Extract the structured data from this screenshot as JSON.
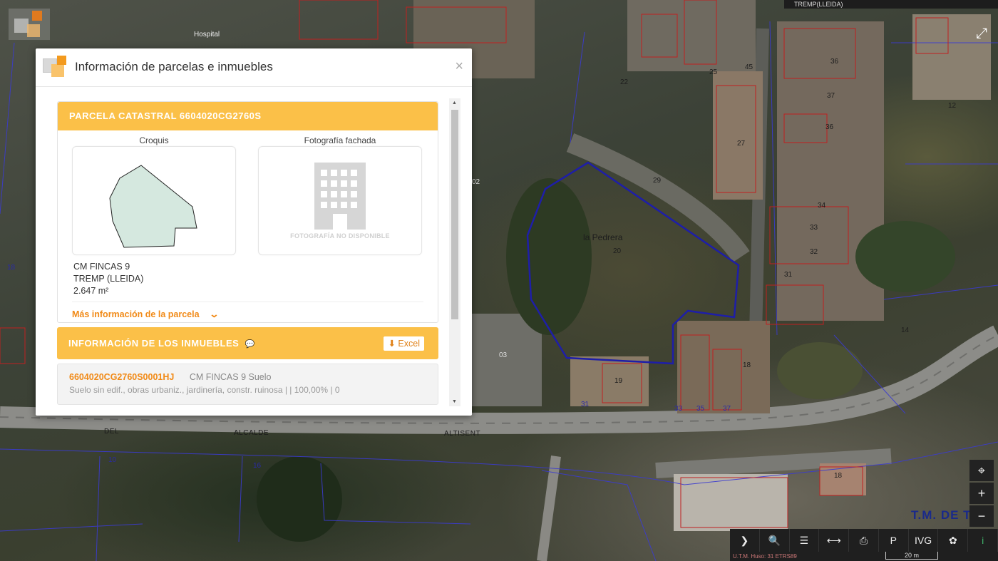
{
  "map": {
    "top_title": "TREMP(LLEIDA)",
    "place_labels": {
      "pedrera": "la Pedrera",
      "hospital": "Hospital",
      "calle_del": "DEL",
      "calle_alcalde": "ALCALDE",
      "calle_altisent": "ALTISENT",
      "tm": "T.M. DE T"
    },
    "parcel_numbers": {
      "n1": "22",
      "n2": "29",
      "n3": "20",
      "n4": "25",
      "n5": "45",
      "n6": "36",
      "n7": "37",
      "n8": "12",
      "n9": "27",
      "n10": "36",
      "n11": "34",
      "n12": "33",
      "n13": "32",
      "n14": "31",
      "n15": "14",
      "n16": "18",
      "n17": "19",
      "n18": "03",
      "n19": "02",
      "n20": "18",
      "n21": "31",
      "n22": "33",
      "n23": "35",
      "n24": "37",
      "n25": "10",
      "n26": "18",
      "n27": "16"
    },
    "fullscreen_icon": "expand-icon",
    "controls": {
      "locate": "⌖",
      "zoom_in": "+",
      "zoom_out": "−"
    },
    "toolbar": {
      "next": "❯",
      "search": "🔍",
      "layers": "☰",
      "measure": "⟷",
      "print": "⎙",
      "parking": "P",
      "ivg": "IVG",
      "share": "✿",
      "info": "i"
    },
    "scale": {
      "projection": "U.T.M. Huso: 31 ETRS89",
      "distance": "20 m"
    }
  },
  "dialog": {
    "title": "Información de parcelas e inmuebles",
    "close": "×",
    "parcel": {
      "heading": "PARCELA CATASTRAL 6604020CG2760S",
      "sketch_caption": "Croquis",
      "photo_caption": "Fotografía fachada",
      "photo_unavailable": "FOTOGRAFÍA NO DISPONIBLE",
      "address_line1": "CM FINCAS 9",
      "address_line2": "TREMP (LLEIDA)",
      "area": "2.647 m²",
      "more_info": "Más información de la parcela",
      "more_info_chevron": "⌄"
    },
    "inmuebles": {
      "heading": "INFORMACIÓN DE LOS INMUEBLES",
      "comment_icon": "💬",
      "excel_label": "Excel",
      "rows": [
        {
          "ref": "6604020CG2760S0001HJ",
          "use": "CM FINCAS 9 Suelo",
          "detail": "Suelo sin edif., obras urbaniz., jardinería, constr. ruinosa |  | 100,00% | 0"
        }
      ]
    },
    "colors": {
      "accent": "#fbc048",
      "link": "#f18a17",
      "sketch_fill": "#d5e8df"
    }
  }
}
